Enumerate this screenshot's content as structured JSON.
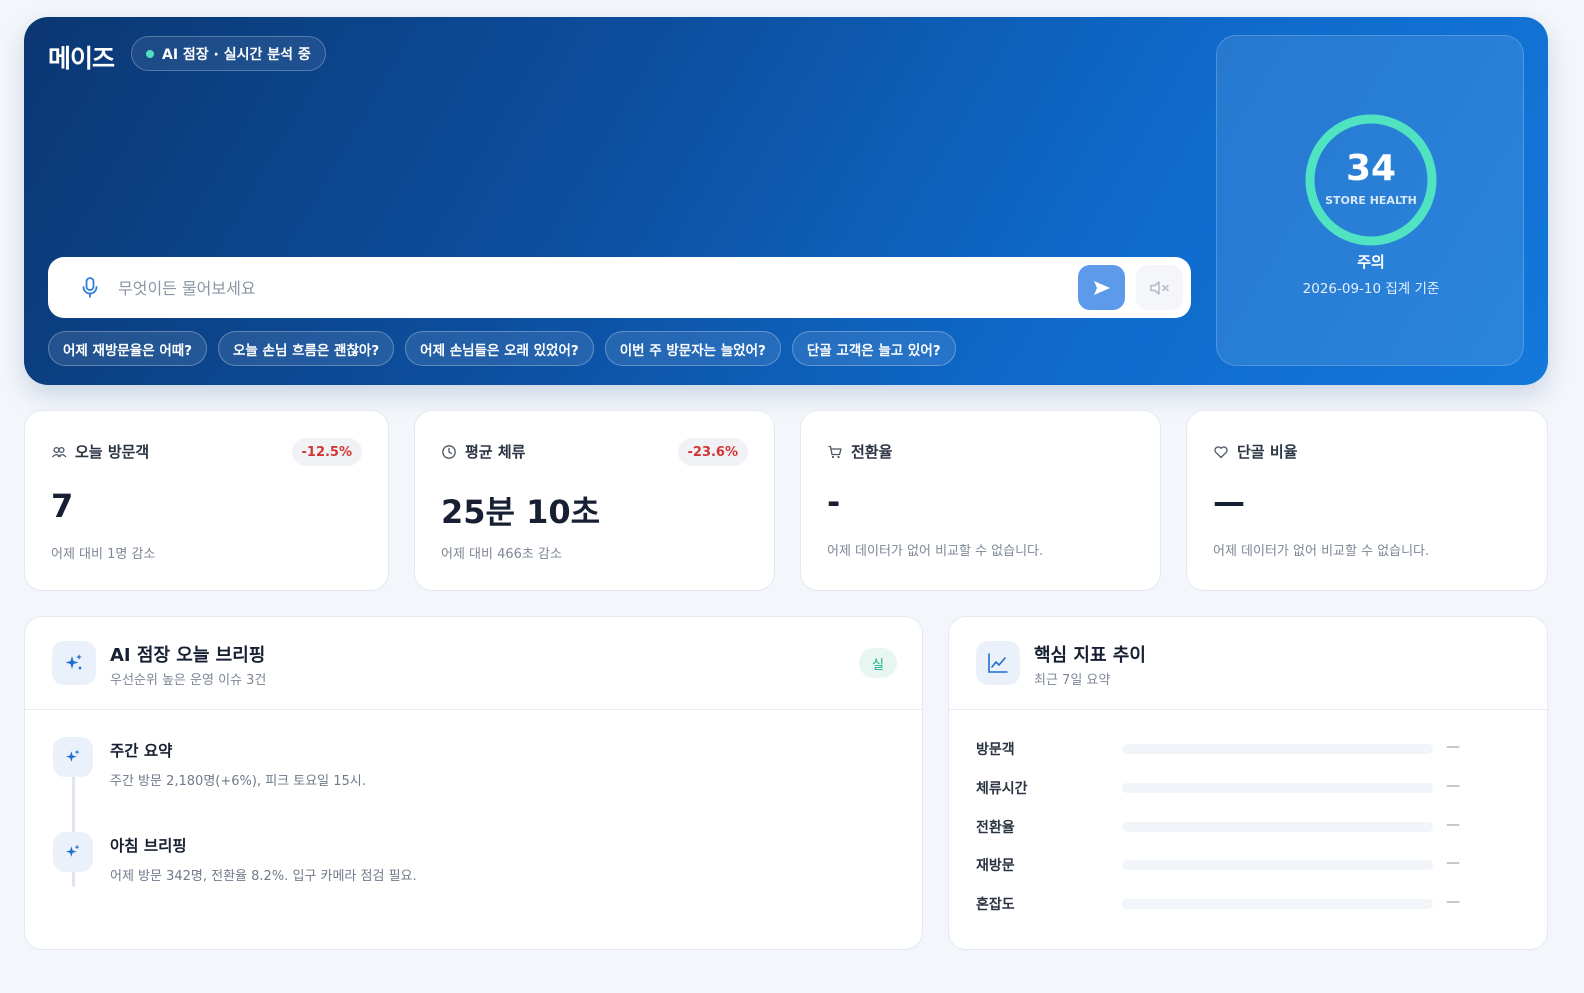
{
  "hero": {
    "brand": "메이즈",
    "status_pill": "AI 점장 · 실시간 분석 중",
    "ask_placeholder": "무엇이든 물어보세요",
    "suggestions": [
      "어제 재방문율은 어때?",
      "오늘 손님 흐름은 괜찮아?",
      "어제 손님들은 오래 있었어?",
      "이번 주 방문자는 늘었어?",
      "단골 고객은 늘고 있어?"
    ]
  },
  "health": {
    "score": "34",
    "caption": "STORE HEALTH",
    "score_fraction": 0.34,
    "status": "주의",
    "date": "2026-09-10 집계 기준",
    "ring_color": "#4fe3c1"
  },
  "kpis": [
    {
      "label": "오늘 방문객",
      "icon": "users-icon",
      "badge": "-12.5%",
      "value": "7",
      "note": "어제 대비 1명 감소"
    },
    {
      "label": "평균 체류",
      "icon": "clock-icon",
      "badge": "-23.6%",
      "value": "25분 10초",
      "note": "어제 대비 466초 감소"
    },
    {
      "label": "전환율",
      "icon": "cart-icon",
      "badge": "",
      "value": "-",
      "note": "어제 데이터가 없어 비교할 수 없습니다."
    },
    {
      "label": "단골 비율",
      "icon": "heart-icon",
      "badge": "",
      "value": "—",
      "note": "어제 데이터가 없어 비교할 수 없습니다."
    }
  ],
  "briefing": {
    "title": "AI 점장 오늘 브리핑",
    "subtitle": "우선순위 높은 운영 이슈 3건",
    "tag": "실",
    "items": [
      {
        "title": "주간 요약",
        "text": "주간 방문 2,180명(+6%), 피크 토요일 15시."
      },
      {
        "title": "아침 브리핑",
        "text": "어제 방문 342명, 전환율 8.2%. 입구 카메라 점검 필요."
      }
    ]
  },
  "metrics": {
    "title": "핵심 지표 추이",
    "subtitle": "최근 7일 요약",
    "rows": [
      {
        "label": "방문객",
        "value": "—"
      },
      {
        "label": "체류시간",
        "value": "—"
      },
      {
        "label": "전환율",
        "value": "—"
      },
      {
        "label": "재방문",
        "value": "—"
      },
      {
        "label": "혼잡도",
        "value": "—"
      }
    ]
  },
  "colors": {
    "accent": "#0f6acb",
    "negative": "#d33434",
    "positive": "#1fae8c"
  }
}
